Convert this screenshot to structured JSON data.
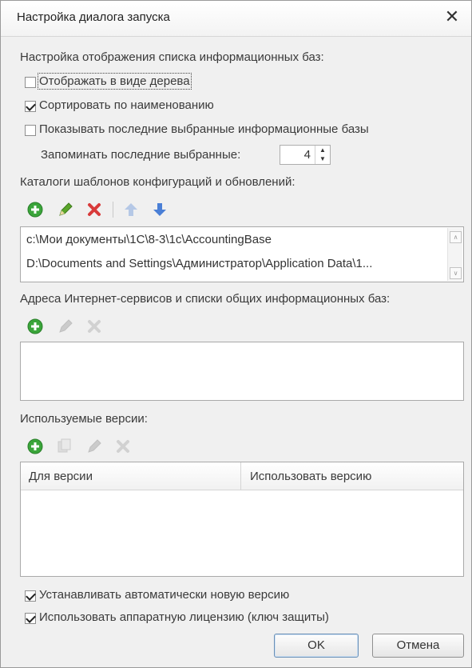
{
  "window": {
    "title": "Настройка диалога запуска",
    "close_glyph": "✕"
  },
  "display_section": {
    "title": "Настройка отображения списка информационных баз:",
    "show_tree": {
      "label": "Отображать в виде дерева",
      "checked": false
    },
    "sort_by_name": {
      "label": "Сортировать по наименованию",
      "checked": true
    },
    "show_recent": {
      "label": "Показывать последние выбранные информационные базы",
      "checked": false
    },
    "remember_recent": {
      "label": "Запоминать последние выбранные:",
      "value": "4"
    }
  },
  "templates_section": {
    "title": "Каталоги шаблонов конфигураций и обновлений:",
    "toolbar": [
      "add-icon",
      "edit-icon",
      "delete-icon",
      "move-up-icon",
      "move-down-icon"
    ],
    "items": [
      "c:\\Мои документы\\1C\\8-3\\1c\\AccountingBase",
      "D:\\Documents and Settings\\Администратор\\Application Data\\1..."
    ]
  },
  "internet_section": {
    "title": "Адреса Интернет-сервисов и списки общих информационных баз:",
    "toolbar": [
      "add-icon",
      "edit-icon",
      "delete-icon"
    ]
  },
  "versions_section": {
    "title": "Используемые версии:",
    "toolbar": [
      "add-icon",
      "copy-icon",
      "edit-icon",
      "delete-icon"
    ],
    "columns": [
      "Для версии",
      "Использовать версию"
    ]
  },
  "auto_install": {
    "label": "Устанавливать автоматически новую версию",
    "checked": true
  },
  "hardware_license": {
    "label": "Использовать аппаратную лицензию (ключ защиты)",
    "checked": true
  },
  "buttons": {
    "ok": "OK",
    "cancel": "Отмена"
  },
  "colors": {
    "add": "#3aa53a",
    "edit": "#5aa52a",
    "delete": "#d83a3a",
    "arrow": "#4a7fd6"
  }
}
